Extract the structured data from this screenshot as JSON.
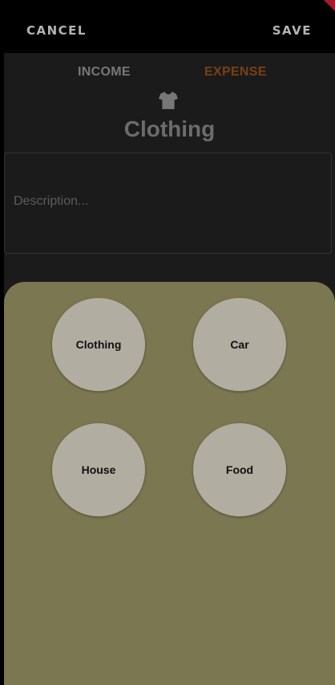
{
  "actions": {
    "cancel_label": "CANCEL",
    "save_label": "SAVE"
  },
  "tabs": {
    "income_label": "INCOME",
    "expense_label": "EXPENSE",
    "active": "EXPENSE"
  },
  "selected_category": {
    "icon": "shirt-icon",
    "title": "Clothing"
  },
  "description": {
    "value": "",
    "placeholder": "Description..."
  },
  "category_sheet": {
    "items": [
      {
        "label": "Clothing"
      },
      {
        "label": "Car"
      },
      {
        "label": "House"
      },
      {
        "label": "Food"
      }
    ]
  },
  "colors": {
    "accent_expense": "#7a3f12",
    "sheet_background": "#7b7751",
    "category_chip": "#b2ada1",
    "debug_banner": "#a8192b"
  }
}
